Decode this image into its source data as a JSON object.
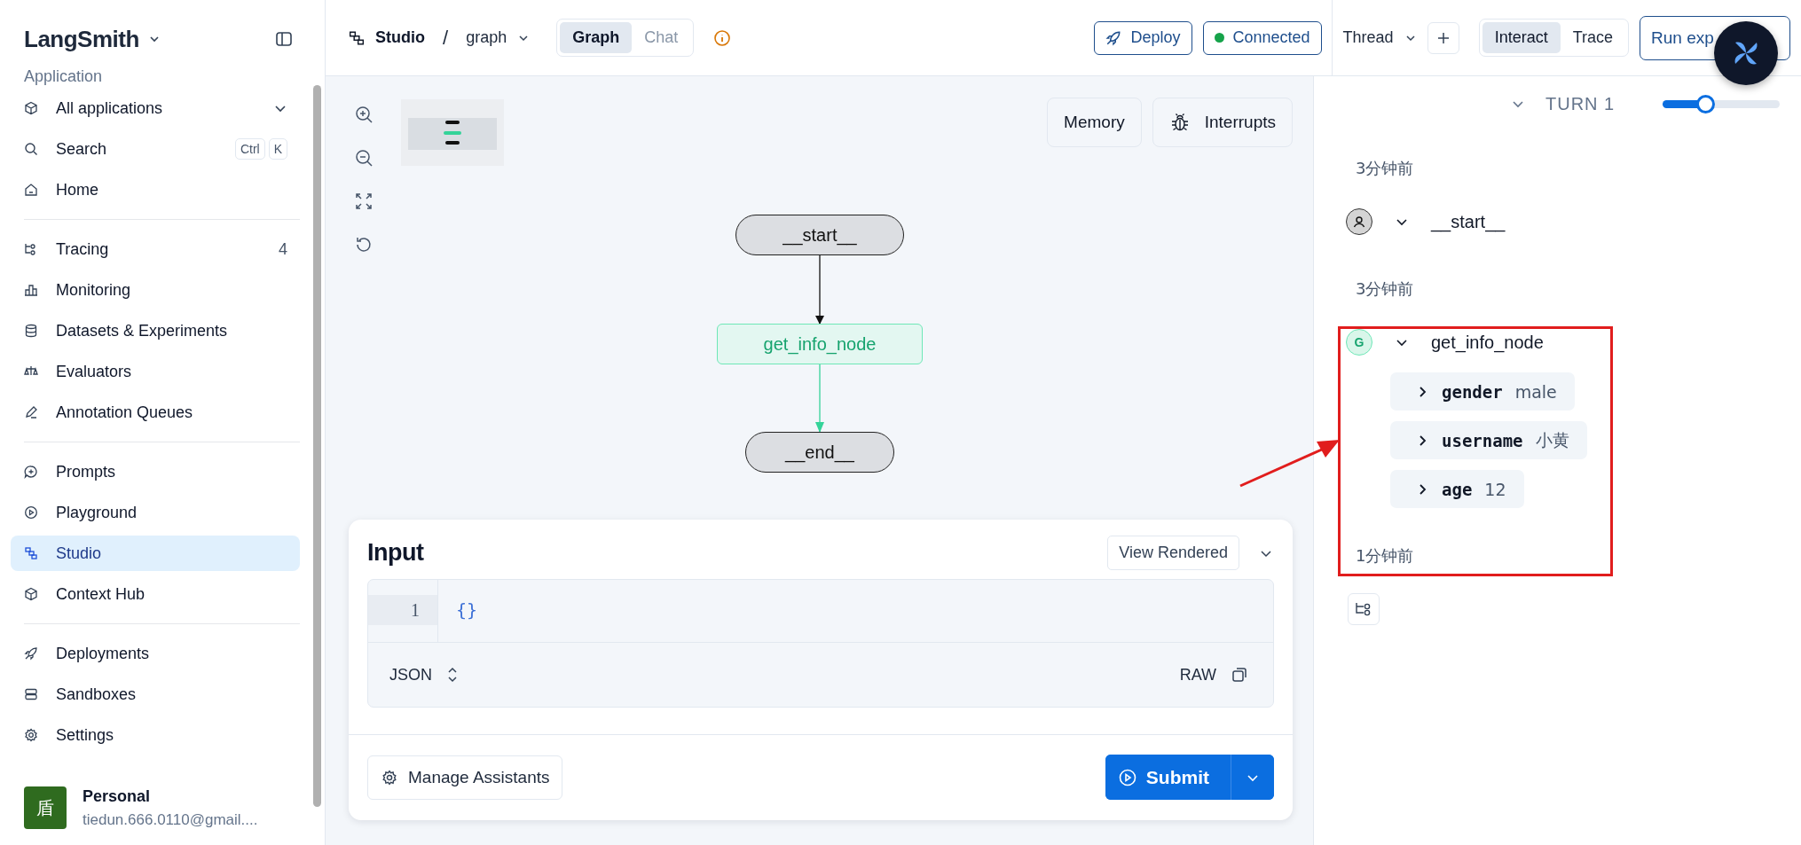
{
  "sidebar": {
    "brand": "LangSmith",
    "section": "Application",
    "app_selector": "All applications",
    "search": {
      "label": "Search",
      "keys": [
        "Ctrl",
        "K"
      ]
    },
    "groups": [
      [
        {
          "label": "Home",
          "selected": false
        }
      ],
      [
        {
          "label": "Tracing",
          "count": "4",
          "selected": false
        },
        {
          "label": "Monitoring",
          "selected": false
        },
        {
          "label": "Datasets & Experiments",
          "selected": false
        },
        {
          "label": "Evaluators",
          "selected": false
        },
        {
          "label": "Annotation Queues",
          "selected": false
        }
      ],
      [
        {
          "label": "Prompts",
          "selected": false
        },
        {
          "label": "Playground",
          "selected": false
        },
        {
          "label": "Studio",
          "selected": true
        },
        {
          "label": "Context Hub",
          "selected": false
        }
      ],
      [
        {
          "label": "Deployments",
          "selected": false
        },
        {
          "label": "Sandboxes",
          "selected": false
        },
        {
          "label": "Settings",
          "selected": false
        }
      ]
    ],
    "account": {
      "avatar": "盾",
      "name": "Personal",
      "email": "tiedun.666.0110@gmail...."
    }
  },
  "topbar": {
    "breadcrumb": [
      "Studio",
      "/",
      "graph"
    ],
    "view_tabs": [
      {
        "label": "Graph",
        "selected": true
      },
      {
        "label": "Chat",
        "selected": false
      }
    ],
    "deploy": "Deploy",
    "status": "Connected",
    "thread": "Thread",
    "mode_tabs": [
      {
        "label": "Interact",
        "selected": true
      },
      {
        "label": "Trace",
        "selected": false
      }
    ],
    "run_button": "Run exp"
  },
  "canvas": {
    "panel_buttons": [
      "Memory",
      "Interrupts"
    ],
    "nodes": [
      {
        "label": "__start__",
        "kind": "terminal",
        "active": false
      },
      {
        "label": "get_info_node",
        "kind": "step",
        "active": true
      },
      {
        "label": "__end__",
        "kind": "terminal",
        "active": false
      }
    ]
  },
  "input": {
    "title": "Input",
    "view_button": "View Rendered",
    "lines": [
      {
        "number": "1",
        "code": "{}"
      }
    ],
    "format": "JSON",
    "raw": "RAW",
    "manage": "Manage Assistants",
    "submit": "Submit"
  },
  "thread": {
    "turn": "TURN 1",
    "level": 0.36,
    "entries": [
      {
        "time": "3分钟前",
        "run": {
          "kind": "user",
          "name": "__start__"
        }
      },
      {
        "time": "3分钟前",
        "run": {
          "kind": "letter",
          "avatar": "G",
          "name": "get_info_node",
          "fields": [
            {
              "key": "gender",
              "value": "male"
            },
            {
              "key": "username",
              "value": "小黄"
            },
            {
              "key": "age",
              "value": "12"
            }
          ]
        }
      },
      {
        "time": "1分钟前"
      }
    ]
  }
}
